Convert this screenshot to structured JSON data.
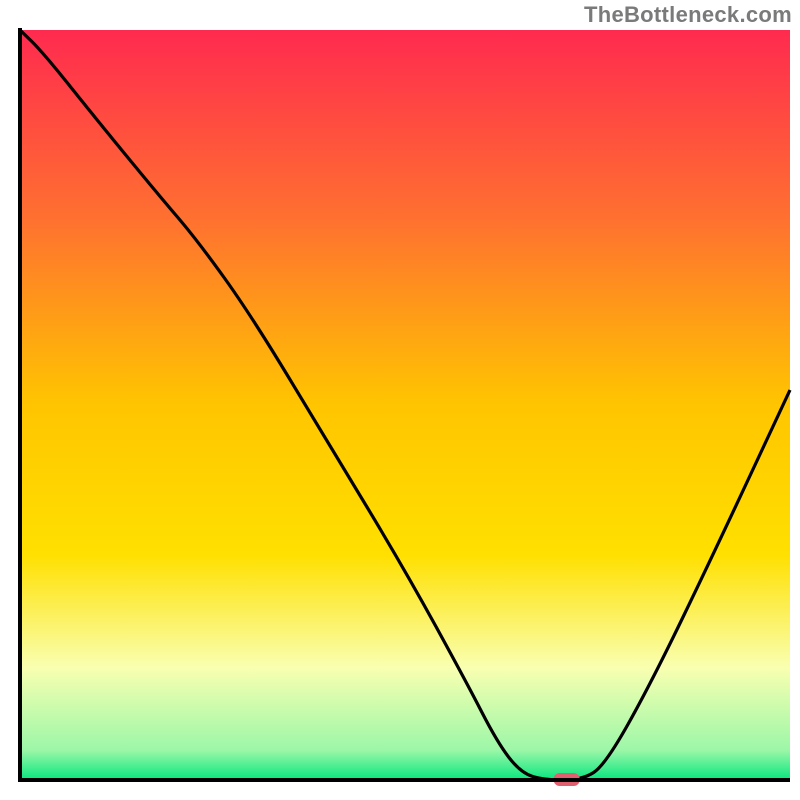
{
  "watermark": "TheBottleneck.com",
  "chart_data": {
    "type": "line",
    "title": "",
    "xlabel": "",
    "ylabel": "",
    "xlim": [
      0,
      100
    ],
    "ylim": [
      0,
      100
    ],
    "grid": false,
    "legend": false,
    "gradient_stops": [
      {
        "offset": 0,
        "color": "#ff2a4f"
      },
      {
        "offset": 0.25,
        "color": "#ff7030"
      },
      {
        "offset": 0.5,
        "color": "#ffc500"
      },
      {
        "offset": 0.7,
        "color": "#ffe000"
      },
      {
        "offset": 0.85,
        "color": "#f9ffb0"
      },
      {
        "offset": 0.96,
        "color": "#9cf7a8"
      },
      {
        "offset": 1.0,
        "color": "#07e77e"
      }
    ],
    "curve": [
      {
        "x": 0,
        "y": 100
      },
      {
        "x": 3,
        "y": 97
      },
      {
        "x": 10,
        "y": 88
      },
      {
        "x": 18,
        "y": 78
      },
      {
        "x": 23,
        "y": 72
      },
      {
        "x": 30,
        "y": 62
      },
      {
        "x": 40,
        "y": 45
      },
      {
        "x": 50,
        "y": 28
      },
      {
        "x": 58,
        "y": 13
      },
      {
        "x": 62,
        "y": 5
      },
      {
        "x": 65,
        "y": 1
      },
      {
        "x": 68,
        "y": 0
      },
      {
        "x": 73,
        "y": 0
      },
      {
        "x": 76,
        "y": 2
      },
      {
        "x": 82,
        "y": 13
      },
      {
        "x": 90,
        "y": 30
      },
      {
        "x": 100,
        "y": 52
      }
    ],
    "marker": {
      "x": 71,
      "y": 0,
      "color": "#e06070"
    },
    "axes_color": "#000000",
    "curve_color": "#000000"
  }
}
